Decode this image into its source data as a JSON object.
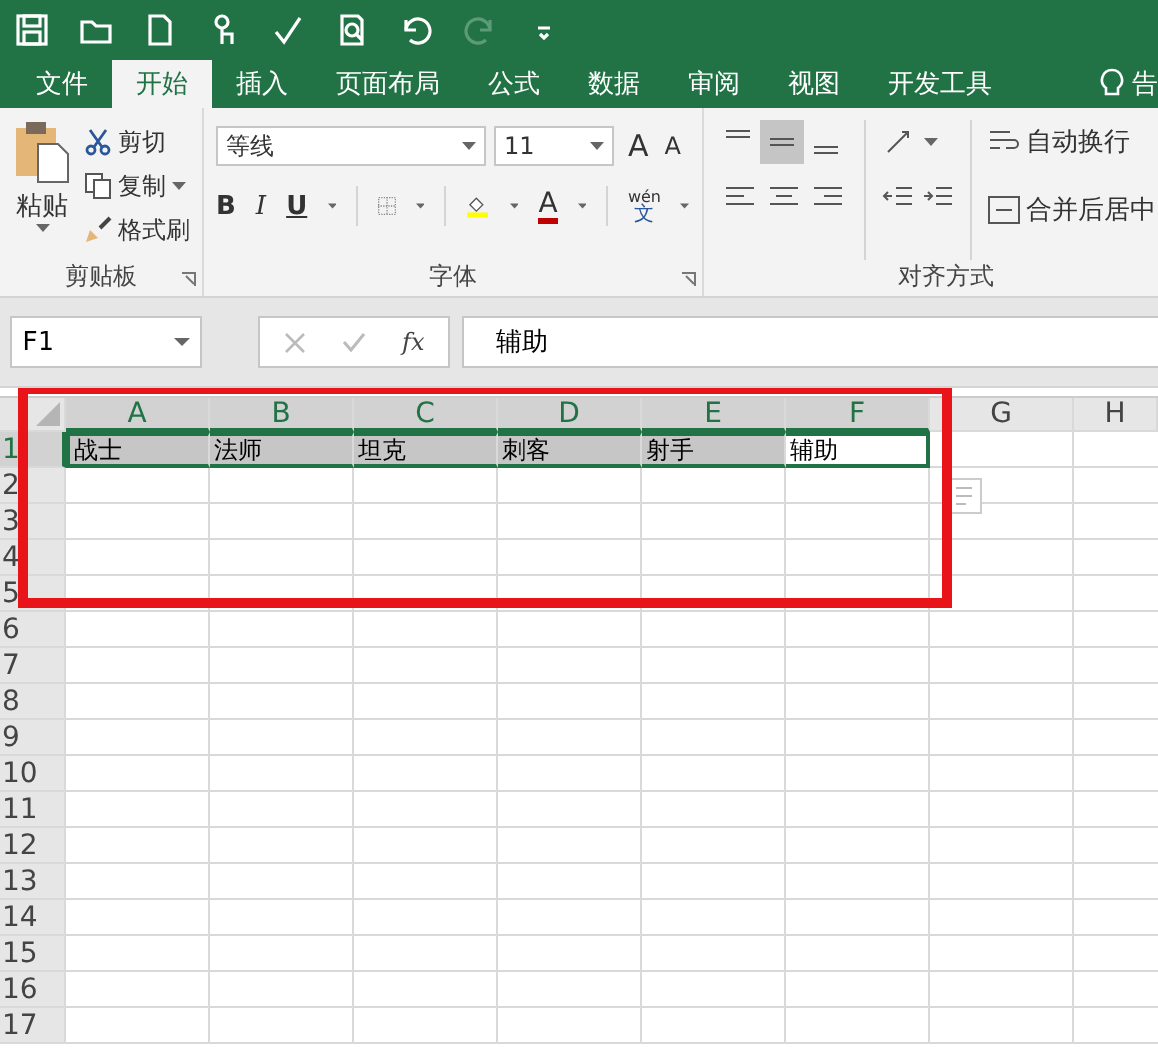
{
  "tabs": [
    {
      "label": "文件",
      "selected": false
    },
    {
      "label": "开始",
      "selected": true
    },
    {
      "label": "插入",
      "selected": false
    },
    {
      "label": "页面布局",
      "selected": false
    },
    {
      "label": "公式",
      "selected": false
    },
    {
      "label": "数据",
      "selected": false
    },
    {
      "label": "审阅",
      "selected": false
    },
    {
      "label": "视图",
      "selected": false
    },
    {
      "label": "开发工具",
      "selected": false
    }
  ],
  "tell_me": "告",
  "clipboard": {
    "paste": "粘贴",
    "cut": "剪切",
    "copy": "复制",
    "format_painter": "格式刷",
    "label": "剪贴板"
  },
  "font": {
    "font_name": "等线",
    "font_size": "11",
    "bold": "B",
    "italic": "I",
    "underline": "U",
    "grow": "A",
    "shrink": "A",
    "font_color": "A",
    "phonetic_top": "wén",
    "phonetic_bottom": "文",
    "label": "字体"
  },
  "alignment": {
    "vertical": [
      {
        "kind": "top",
        "selected": false
      },
      {
        "kind": "middle",
        "selected": true
      },
      {
        "kind": "bottom",
        "selected": false
      }
    ],
    "wrap_text": "自动换行",
    "merge_center": "合并后居中",
    "label": "对齐方式"
  },
  "formula_bar": {
    "name_box": "F1",
    "fx": "fx",
    "value": "辅助"
  },
  "grid": {
    "columns": [
      {
        "label": "A",
        "selected": true
      },
      {
        "label": "B",
        "selected": true
      },
      {
        "label": "C",
        "selected": true
      },
      {
        "label": "D",
        "selected": true
      },
      {
        "label": "E",
        "selected": true
      },
      {
        "label": "F",
        "selected": true
      },
      {
        "label": "G",
        "selected": false
      },
      {
        "label": "H",
        "selected": false
      }
    ],
    "rows": [
      {
        "label": "1",
        "selected": true,
        "cells": [
          {
            "value": "战士",
            "selected": true,
            "active": false
          },
          {
            "value": "法师",
            "selected": true,
            "active": false
          },
          {
            "value": "坦克",
            "selected": true,
            "active": false
          },
          {
            "value": "刺客",
            "selected": true,
            "active": false
          },
          {
            "value": "射手",
            "selected": true,
            "active": false
          },
          {
            "value": "辅助",
            "selected": true,
            "active": true
          }
        ]
      },
      {
        "label": "2",
        "selected": false
      },
      {
        "label": "3",
        "selected": false
      },
      {
        "label": "4",
        "selected": false
      },
      {
        "label": "5",
        "selected": false
      },
      {
        "label": "6",
        "selected": false
      },
      {
        "label": "7",
        "selected": false
      },
      {
        "label": "8",
        "selected": false
      },
      {
        "label": "9",
        "selected": false
      },
      {
        "label": "10",
        "selected": false
      },
      {
        "label": "11",
        "selected": false
      },
      {
        "label": "12",
        "selected": false
      },
      {
        "label": "13",
        "selected": false
      },
      {
        "label": "14",
        "selected": false
      },
      {
        "label": "15",
        "selected": false
      },
      {
        "label": "16",
        "selected": false
      },
      {
        "label": "17",
        "selected": false
      }
    ]
  }
}
